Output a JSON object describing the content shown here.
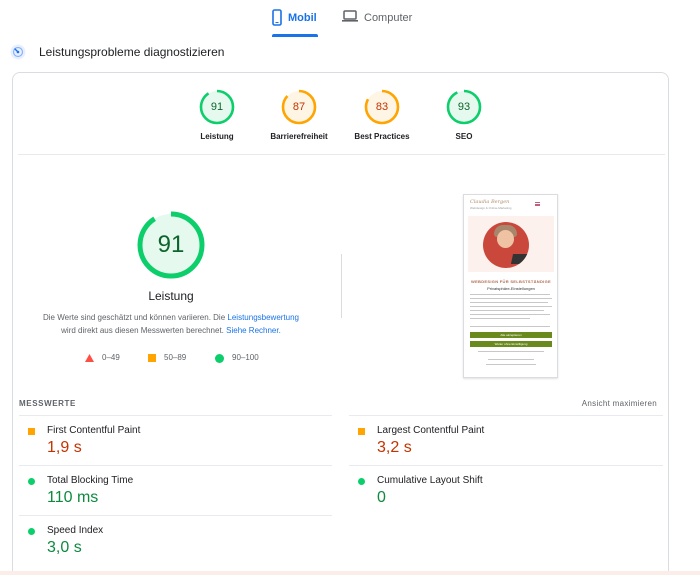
{
  "tabs": {
    "mobile": "Mobil",
    "desktop": "Computer"
  },
  "section": {
    "title": "Leistungsprobleme diagnostizieren"
  },
  "gauges": [
    {
      "score": "91",
      "label": "Leistung",
      "status": "pass"
    },
    {
      "score": "87",
      "label": "Barrierefreiheit",
      "status": "average"
    },
    {
      "score": "83",
      "label": "Best Practices",
      "status": "average"
    },
    {
      "score": "93",
      "label": "SEO",
      "status": "pass"
    }
  ],
  "main_score": {
    "score": "91",
    "title": "Leistung",
    "desc_1": "Die Werte sind geschätzt und können variieren. Die ",
    "link_1": "Leistungsbewertung",
    "desc_2": "wird direkt aus diesen Messwerten berechnet. ",
    "link_2": "Siehe Rechner."
  },
  "legend": {
    "fail": "0–49",
    "average": "50–89",
    "pass": "90–100"
  },
  "screenshot_page": {
    "logo": "Claudia Bergen",
    "logo_sub": "Webdesign & Online-Marketing",
    "headline": "WEBDESIGN FÜR SELBSTSTÄNDIGE",
    "subhead": "Privatsphäre-Einstellungen",
    "button_accept": "Alle akzeptieren",
    "button_continue": "Weiter ohne Einwilligung"
  },
  "metrics": {
    "heading": "MESSWERTE",
    "expand_label": "Ansicht maximieren",
    "items": [
      {
        "label": "First Contentful Paint",
        "value": "1,9 s",
        "status": "average"
      },
      {
        "label": "Largest Contentful Paint",
        "value": "3,2 s",
        "status": "average"
      },
      {
        "label": "Total Blocking Time",
        "value": "110 ms",
        "status": "pass"
      },
      {
        "label": "Cumulative Layout Shift",
        "value": "0",
        "status": "pass"
      },
      {
        "label": "Speed Index",
        "value": "3,0 s",
        "status": "pass"
      }
    ]
  },
  "colors": {
    "accent": "#1a73e8",
    "pass": "#0cce6b",
    "pass_text": "#0d8a3f",
    "average": "#ffa400",
    "average_text": "#c33300",
    "fail": "#ff4e42"
  },
  "icons": {
    "mobile_tab": "smartphone-icon",
    "desktop_tab": "laptop-icon",
    "diagnose": "performance-diagnose-icon"
  }
}
